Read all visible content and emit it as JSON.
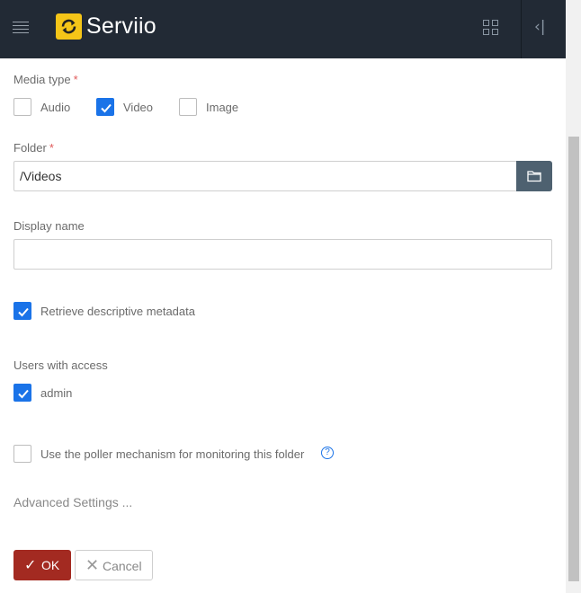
{
  "header": {
    "brand": "Serviio",
    "menu_icon": "hamburger-menu-icon",
    "apps_icon": "grid-icon",
    "collapse_icon": "collapse-panel-icon",
    "collapse_glyph": "‹|"
  },
  "form": {
    "media_type": {
      "label": "Media type",
      "required_mark": "*",
      "options": [
        {
          "label": "Audio",
          "checked": false
        },
        {
          "label": "Video",
          "checked": true
        },
        {
          "label": "Image",
          "checked": false
        }
      ]
    },
    "folder": {
      "label": "Folder",
      "required_mark": "*",
      "value": "/Videos",
      "browse_icon": "folder-icon"
    },
    "display_name": {
      "label": "Display name",
      "value": ""
    },
    "retrieve_metadata": {
      "label": "Retrieve descriptive metadata",
      "checked": true
    },
    "users_with_access": {
      "label": "Users with access",
      "users": [
        {
          "label": "admin",
          "checked": true
        }
      ]
    },
    "poller": {
      "label": "Use the poller mechanism for monitoring this folder",
      "checked": false,
      "help_glyph": "?"
    },
    "advanced_settings": "Advanced Settings ..."
  },
  "actions": {
    "ok_label": "OK",
    "ok_glyph": "✓",
    "cancel_label": "Cancel",
    "cancel_glyph": "✕"
  },
  "colors": {
    "header_bg": "#222a35",
    "accent": "#1a73e8",
    "ok_button": "#a32a21",
    "browse_button": "#4e6170",
    "logo": "#f5c518"
  }
}
